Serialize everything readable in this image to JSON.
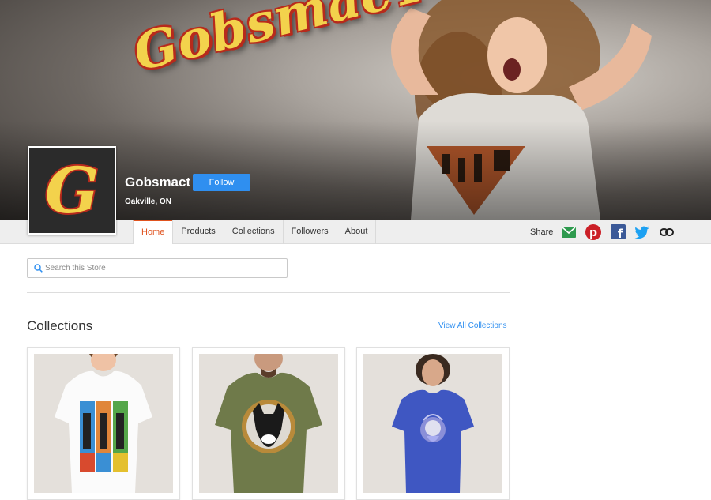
{
  "store": {
    "wordmark": "GobsmacT",
    "avatar_letter": "G",
    "name": "Gobsmact",
    "location": "Oakville, ON",
    "follow_label": "Follow"
  },
  "nav": {
    "tabs": [
      {
        "label": "Home",
        "active": true
      },
      {
        "label": "Products",
        "active": false
      },
      {
        "label": "Collections",
        "active": false
      },
      {
        "label": "Followers",
        "active": false
      },
      {
        "label": "About",
        "active": false
      }
    ],
    "share_label": "Share",
    "share_icons": [
      "email-icon",
      "pinterest-icon",
      "facebook-icon",
      "twitter-icon",
      "link-icon"
    ]
  },
  "search": {
    "placeholder": "Search this Store",
    "value": ""
  },
  "collections": {
    "title": "Collections",
    "view_all_label": "View All Collections",
    "cards": [
      {
        "icon": "white-tshirt-photo"
      },
      {
        "icon": "green-tshirt-photo"
      },
      {
        "icon": "blue-tshirt-photo"
      }
    ]
  },
  "colors": {
    "accent": "#e0531f",
    "link": "#2f8ff0",
    "email": "#2e9a4e",
    "pinterest": "#cb1f27",
    "facebook": "#3b5998",
    "twitter": "#1da1f2"
  }
}
